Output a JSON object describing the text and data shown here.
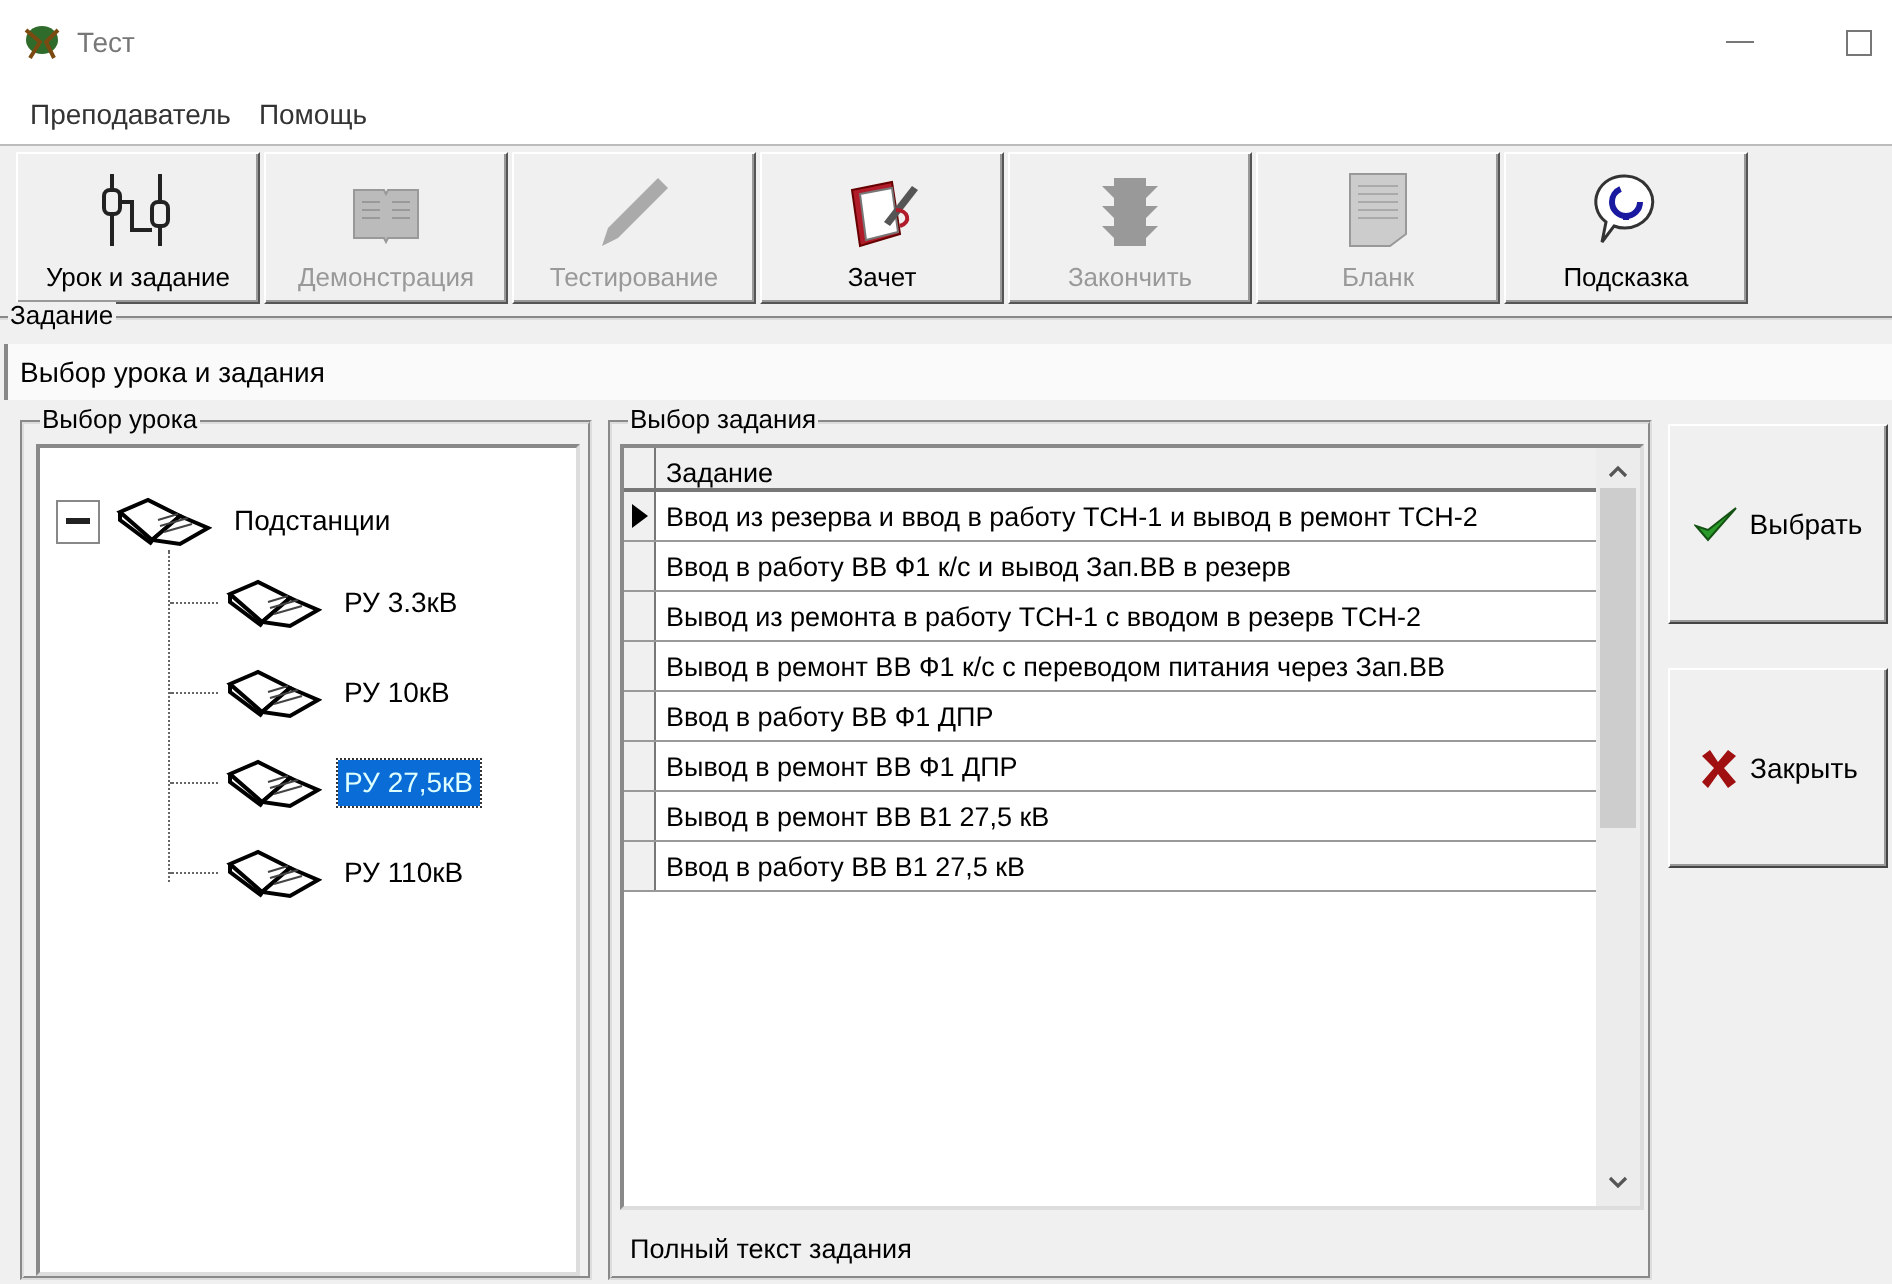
{
  "window": {
    "title": "Тест"
  },
  "menu": [
    "Преподаватель",
    "Помощь"
  ],
  "toolbar": [
    {
      "label": "Урок и задание",
      "kind": "circuit",
      "disabled": false
    },
    {
      "label": "Демонстрация",
      "kind": "book",
      "disabled": true
    },
    {
      "label": "Тестирование",
      "kind": "pencil",
      "disabled": true
    },
    {
      "label": "Зачет",
      "kind": "notebook",
      "disabled": false
    },
    {
      "label": "Закончить",
      "kind": "lights",
      "disabled": true
    },
    {
      "label": "Бланк",
      "kind": "form",
      "disabled": true
    },
    {
      "label": "Подсказка",
      "kind": "help",
      "disabled": false
    }
  ],
  "task_group": {
    "title": "Задание",
    "value": "Выбор урока и задания"
  },
  "lesson_group": {
    "title": "Выбор урока",
    "tree": [
      {
        "label": "Подстанции",
        "expanded": true,
        "selected": false,
        "children": [
          {
            "label": "РУ 3.3кВ",
            "selected": false
          },
          {
            "label": "РУ 10кВ",
            "selected": false
          },
          {
            "label": "РУ 27,5кВ",
            "selected": true
          },
          {
            "label": "РУ 110кВ",
            "selected": false
          }
        ]
      }
    ]
  },
  "task_select": {
    "title": "Выбор задания",
    "columns": [
      "Задание"
    ],
    "rows": [
      {
        "text": "Ввод из резерва и ввод в работу ТСН-1 и вывод в ремонт ТСН-2",
        "selected": true
      },
      {
        "text": "Ввод в работу ВВ Ф1 к/с и вывод Зап.ВВ в резерв",
        "selected": false
      },
      {
        "text": "Вывод из ремонта в работу ТСН-1 с вводом в резерв ТСН-2",
        "selected": false
      },
      {
        "text": "Вывод в ремонт ВВ Ф1 к/с с переводом питания через Зап.ВВ",
        "selected": false
      },
      {
        "text": "Ввод в работу ВВ Ф1 ДПР",
        "selected": false
      },
      {
        "text": "Вывод в ремонт ВВ Ф1 ДПР",
        "selected": false
      },
      {
        "text": "Вывод в ремонт ВВ В1 27,5 кВ",
        "selected": false
      },
      {
        "text": "Ввод в работу ВВ В1 27,5 кВ",
        "selected": false
      }
    ],
    "full_text_label": "Полный текст задания"
  },
  "actions": [
    {
      "label": "Выбрать",
      "kind": "ok"
    },
    {
      "label": "Закрыть",
      "kind": "close"
    }
  ]
}
